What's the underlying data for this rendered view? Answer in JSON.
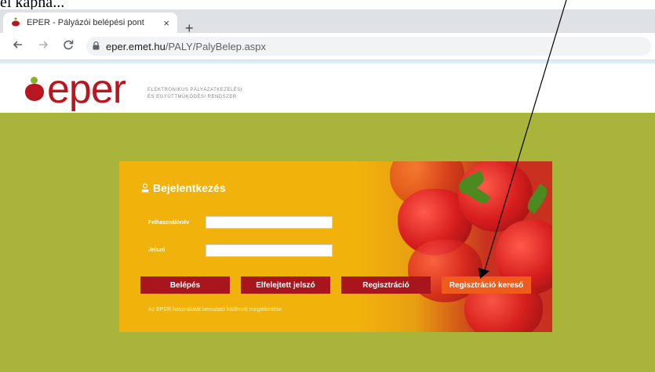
{
  "caption": "el kapna...",
  "browser": {
    "tab_title": "EPER - Pályázói belépési pont",
    "tab_close": "×",
    "new_tab": "+",
    "url_host": "eper.emet.hu",
    "url_path": "/PALY/PalyBelep.aspx"
  },
  "brand": {
    "logo": "eper",
    "tagline_1": "ELEKTRONIKUS PÁLYÁZATKEZELÉSI",
    "tagline_2": "ÉS EGYÜTTMŰKÖDÉSI RENDSZER"
  },
  "login": {
    "title": "Bejelentkezés",
    "username_label": "Felhasználónév",
    "password_label": "Jelszó",
    "buttons": {
      "login": "Belépés",
      "forgot": "Elfelejtett jelszó",
      "register": "Regisztráció",
      "register_search": "Regisztráció kereső"
    },
    "help_link": "Az EPER használatát bemutató kisfilmek megtekintése"
  },
  "colors": {
    "brand_red": "#b8171f",
    "page_green": "#a8b53a",
    "card_yellow": "#f1b20c",
    "accent_orange": "#ee5b1b"
  }
}
